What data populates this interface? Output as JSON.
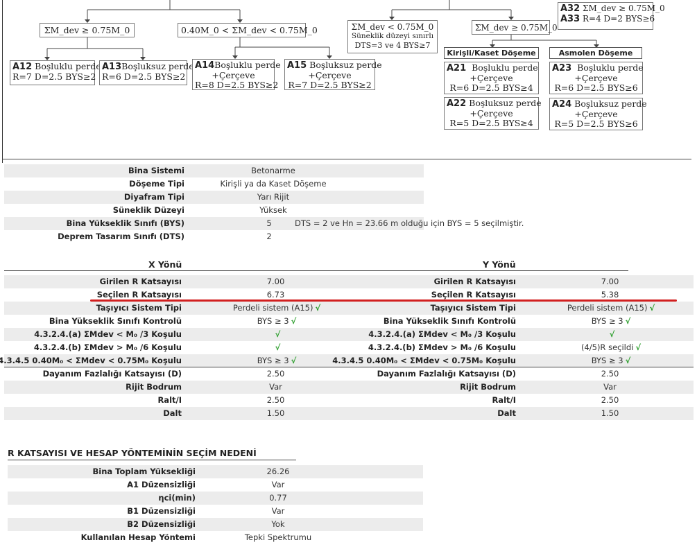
{
  "tree": {
    "cond_a": "ΣM_dev ≥ 0.75M_0",
    "cond_b": "0.40M_0 < ΣM_dev < 0.75M_0",
    "cond_c_line1": "ΣM_dev < 0.75M_0",
    "cond_c_line2": "Süneklik düzeyi sınırlı",
    "cond_c_line3": "DTS=3 ve 4 BYS≥7",
    "cond_d": "ΣM_dev ≥ 0.75M_0",
    "cond_e": "ΣM_dev ≥ 0.75M_0",
    "leaves": [
      {
        "code": "A12",
        "name": "Boşluklu perde",
        "line2": "",
        "params": "R=7 D=2.5 BYS≥2"
      },
      {
        "code": "A13",
        "name": "Boşluksuz perde",
        "line2": "",
        "params": "R=6 D=2.5 BYS≥2"
      },
      {
        "code": "A14",
        "name": "Boşluklu perde",
        "line2": "+Çerçeve",
        "params": "R=8 D=2.5 BYS≥2"
      },
      {
        "code": "A15",
        "name": "Boşluksuz perde",
        "line2": "+Çerçeve",
        "params": "R=7 D=2.5 BYS≥2"
      },
      {
        "code": "A21",
        "name": "Boşluklu perde",
        "line2": "+Çerçeve",
        "params": "R=6 D=2.5 BYS≥4"
      },
      {
        "code": "A22",
        "name": "Boşluksuz perde",
        "line2": "+Çerçeve",
        "params": "R=5 D=2.5 BYS≥4"
      },
      {
        "code": "A23",
        "name": "Boşluklu perde",
        "line2": "+Çerçeve",
        "params": "R=6 D=2.5 BYS≥6"
      },
      {
        "code": "A24",
        "name": "Boşluksuz perde",
        "line2": "+Çerçeve",
        "params": "R=5 D=2.5 BYS≥6"
      }
    ],
    "a32": "A32",
    "a33": "A33",
    "a32_params": "R=4  D=2 BYS≥6",
    "cat_left": "Kirişli/Kaset Döşeme",
    "cat_right": "Asmolen Döşeme"
  },
  "building": [
    {
      "label": "Bina Sistemi",
      "value": "Betonarme",
      "note": ""
    },
    {
      "label": "Döşeme Tipi",
      "value": "Kirişli ya da Kaset Döşeme",
      "note": ""
    },
    {
      "label": "Diyafram Tipi",
      "value": "Yarı Rijit",
      "note": ""
    },
    {
      "label": "Süneklik Düzeyi",
      "value": "Yüksek",
      "note": ""
    },
    {
      "label": "Bina Yükseklik Sınıfı (BYS)",
      "value": "5",
      "note": "DTS = 2 ve Hn = 23.66 m olduğu için  BYS = 5 seçilmiştir."
    },
    {
      "label": "Deprem Tasarım Sınıfı (DTS)",
      "value": "2",
      "note": ""
    }
  ],
  "x_header": "X Yönü",
  "y_header": "Y Yönü",
  "dir_rows": [
    {
      "label": "Girilen R Katsayısı",
      "x": "7.00",
      "xok": "",
      "y": "7.00",
      "yok": ""
    },
    {
      "label": "Seçilen R Katsayısı",
      "x": "6.73",
      "xok": "",
      "y": "5.38",
      "yok": ""
    },
    {
      "label": "Taşıyıcı Sistem Tipi",
      "x": "Perdeli sistem (A15)",
      "xok": "√",
      "y": "Perdeli sistem (A15)",
      "yok": "√"
    },
    {
      "label": "Bina Yükseklik Sınıfı Kontrolü",
      "x": "BYS ≥ 3",
      "xok": "√",
      "y": "BYS ≥ 3",
      "yok": "√"
    },
    {
      "label": "4.3.2.4.(a) ΣMdev < M₀ /3 Koşulu",
      "x": "",
      "xok": "√",
      "y": "",
      "yok": "√"
    },
    {
      "label": "4.3.2.4.(b) ΣMdev > M₀ /6 Koşulu",
      "x": "",
      "xok": "√",
      "y": "(4/5)R seçildi",
      "yok": "√"
    },
    {
      "label": "4.3.4.5 0.40M₀  < ΣMdev < 0.75M₀  Koşulu",
      "x": "BYS ≥ 3",
      "xok": "√",
      "y": "BYS ≥ 3",
      "yok": "√"
    },
    {
      "label": "Dayanım Fazlalığı Katsayısı (D)",
      "x": "2.50",
      "xok": "",
      "y": "2.50",
      "yok": ""
    },
    {
      "label": "Rijit Bodrum",
      "x": "Var",
      "xok": "",
      "y": "Var",
      "yok": ""
    },
    {
      "label": "Ralt/I",
      "x": "2.50",
      "xok": "",
      "y": "2.50",
      "yok": ""
    },
    {
      "label": "Dalt",
      "x": "1.50",
      "xok": "",
      "y": "1.50",
      "yok": ""
    }
  ],
  "reason_title": "R KATSAYISI VE HESAP YÖNTEMİNİN SEÇİM NEDENİ",
  "reason_rows": [
    {
      "label": "Bina Toplam Yüksekliği",
      "value": "26.26"
    },
    {
      "label": "A1 Düzensizliği",
      "value": "Var"
    },
    {
      "label": "ηci(min)",
      "value": "0.77"
    },
    {
      "label": "B1 Düzensizliği",
      "value": "Var"
    },
    {
      "label": "B2 Düzensizliği",
      "value": "Yok"
    },
    {
      "label": "Kullanılan Hesap Yöntemi",
      "value": "Tepki Spektrumu"
    }
  ],
  "colors": {
    "check": "#2a9d2a",
    "highlight": "#d21f1f",
    "shade": "#ececec"
  }
}
